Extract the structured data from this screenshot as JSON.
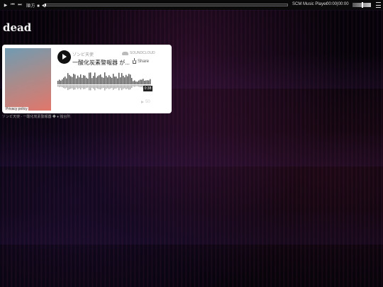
{
  "player": {
    "mode_label": "順方 ■ ◀",
    "title": "SCM Music Player",
    "time": "00:00|00:00",
    "icons": [
      "play-icon",
      "prev-icon",
      "next-icon",
      "menu-icon"
    ]
  },
  "page": {
    "heading": "dead"
  },
  "widget": {
    "artist": "ゾンビ天使",
    "track": "一酸化炭素警報器 が...",
    "soundcloud_label": "SOUNDCLOUD",
    "share_label": "Share",
    "privacy_label": "Privacy policy",
    "duration": "0:38",
    "play_count": "50"
  },
  "caption": "ゾンビ天使 - 一酸化炭素警報器 ◆ ♦ 独台所"
}
